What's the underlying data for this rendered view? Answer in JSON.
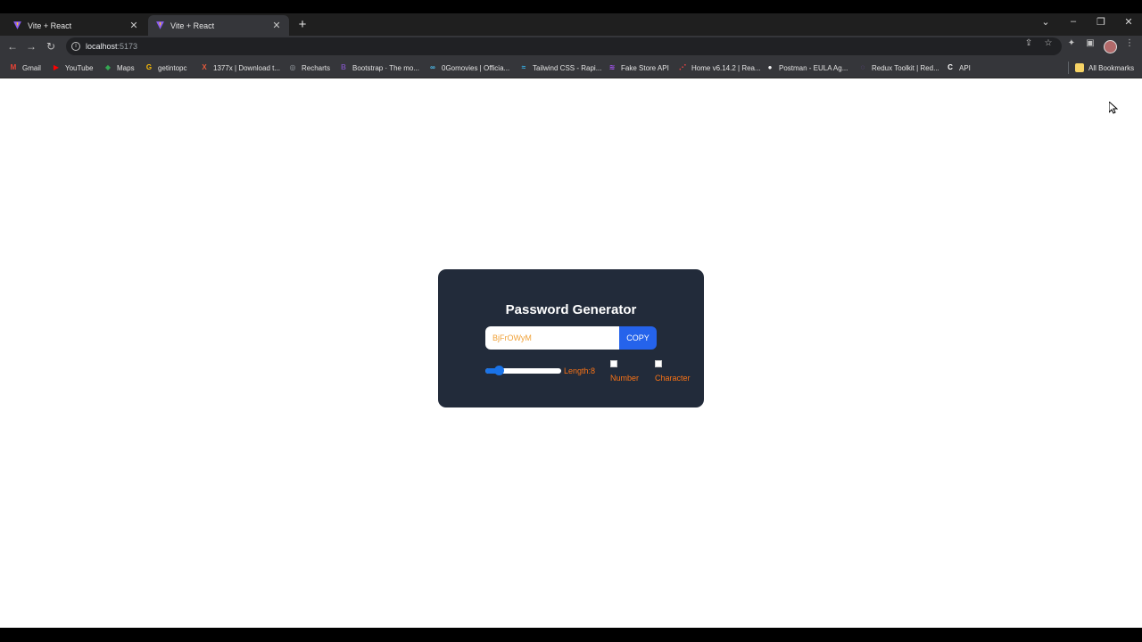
{
  "browser": {
    "tabs": [
      {
        "title": "Vite + React",
        "close": "✕"
      },
      {
        "title": "Vite + React",
        "close": "✕"
      }
    ],
    "new_tab": "+",
    "window_controls": {
      "list": "⌄",
      "minimize": "–",
      "restore": "❐",
      "close": "✕"
    },
    "nav": {
      "back": "←",
      "forward": "→",
      "reload": "↻"
    },
    "address": {
      "info": "i",
      "host": "localhost",
      "port": ":5173"
    },
    "toolbar_icons": {
      "share": "⇪",
      "star": "☆",
      "extensions": "✦",
      "sidepanel": "▣",
      "menu": "⋮"
    },
    "bookmarks": [
      {
        "label": "Gmail",
        "icon": "M",
        "color": "#ea4335"
      },
      {
        "label": "YouTube",
        "icon": "▶",
        "color": "#ff0000"
      },
      {
        "label": "Maps",
        "icon": "◆",
        "color": "#34a853"
      },
      {
        "label": "getintopc",
        "icon": "G",
        "color": "#fbbc05"
      },
      {
        "label": "1377x | Download t...",
        "icon": "X",
        "color": "#e55b3c"
      },
      {
        "label": "Recharts",
        "icon": "◎",
        "color": "#9aa0a6"
      },
      {
        "label": "Bootstrap · The mo...",
        "icon": "B",
        "color": "#7952b3"
      },
      {
        "label": "0Gomovies | Officia...",
        "icon": "∞",
        "color": "#4fc3f7"
      },
      {
        "label": "Tailwind CSS - Rapi...",
        "icon": "≈",
        "color": "#38bdf8"
      },
      {
        "label": "Fake Store API",
        "icon": "≋",
        "color": "#a855f7"
      },
      {
        "label": "Home v6.14.2 | Rea...",
        "icon": "⋰",
        "color": "#ef4444"
      },
      {
        "label": "Postman - EULA Ag...",
        "icon": "●",
        "color": "#f4f4f4"
      },
      {
        "label": "Redux Toolkit | Red...",
        "icon": "◌",
        "color": "#764abc"
      },
      {
        "label": "API",
        "icon": "C",
        "color": "#ffffff"
      }
    ],
    "all_bookmarks": "All Bookmarks"
  },
  "app": {
    "title": "Password Generator",
    "password": "BjFrOWyM",
    "copy_label": "COPY",
    "length_label": "Length:8",
    "length_value": 8,
    "length_min": 6,
    "length_max": 100,
    "number_label": "Number",
    "number_checked": false,
    "character_label": "Character",
    "character_checked": false
  }
}
